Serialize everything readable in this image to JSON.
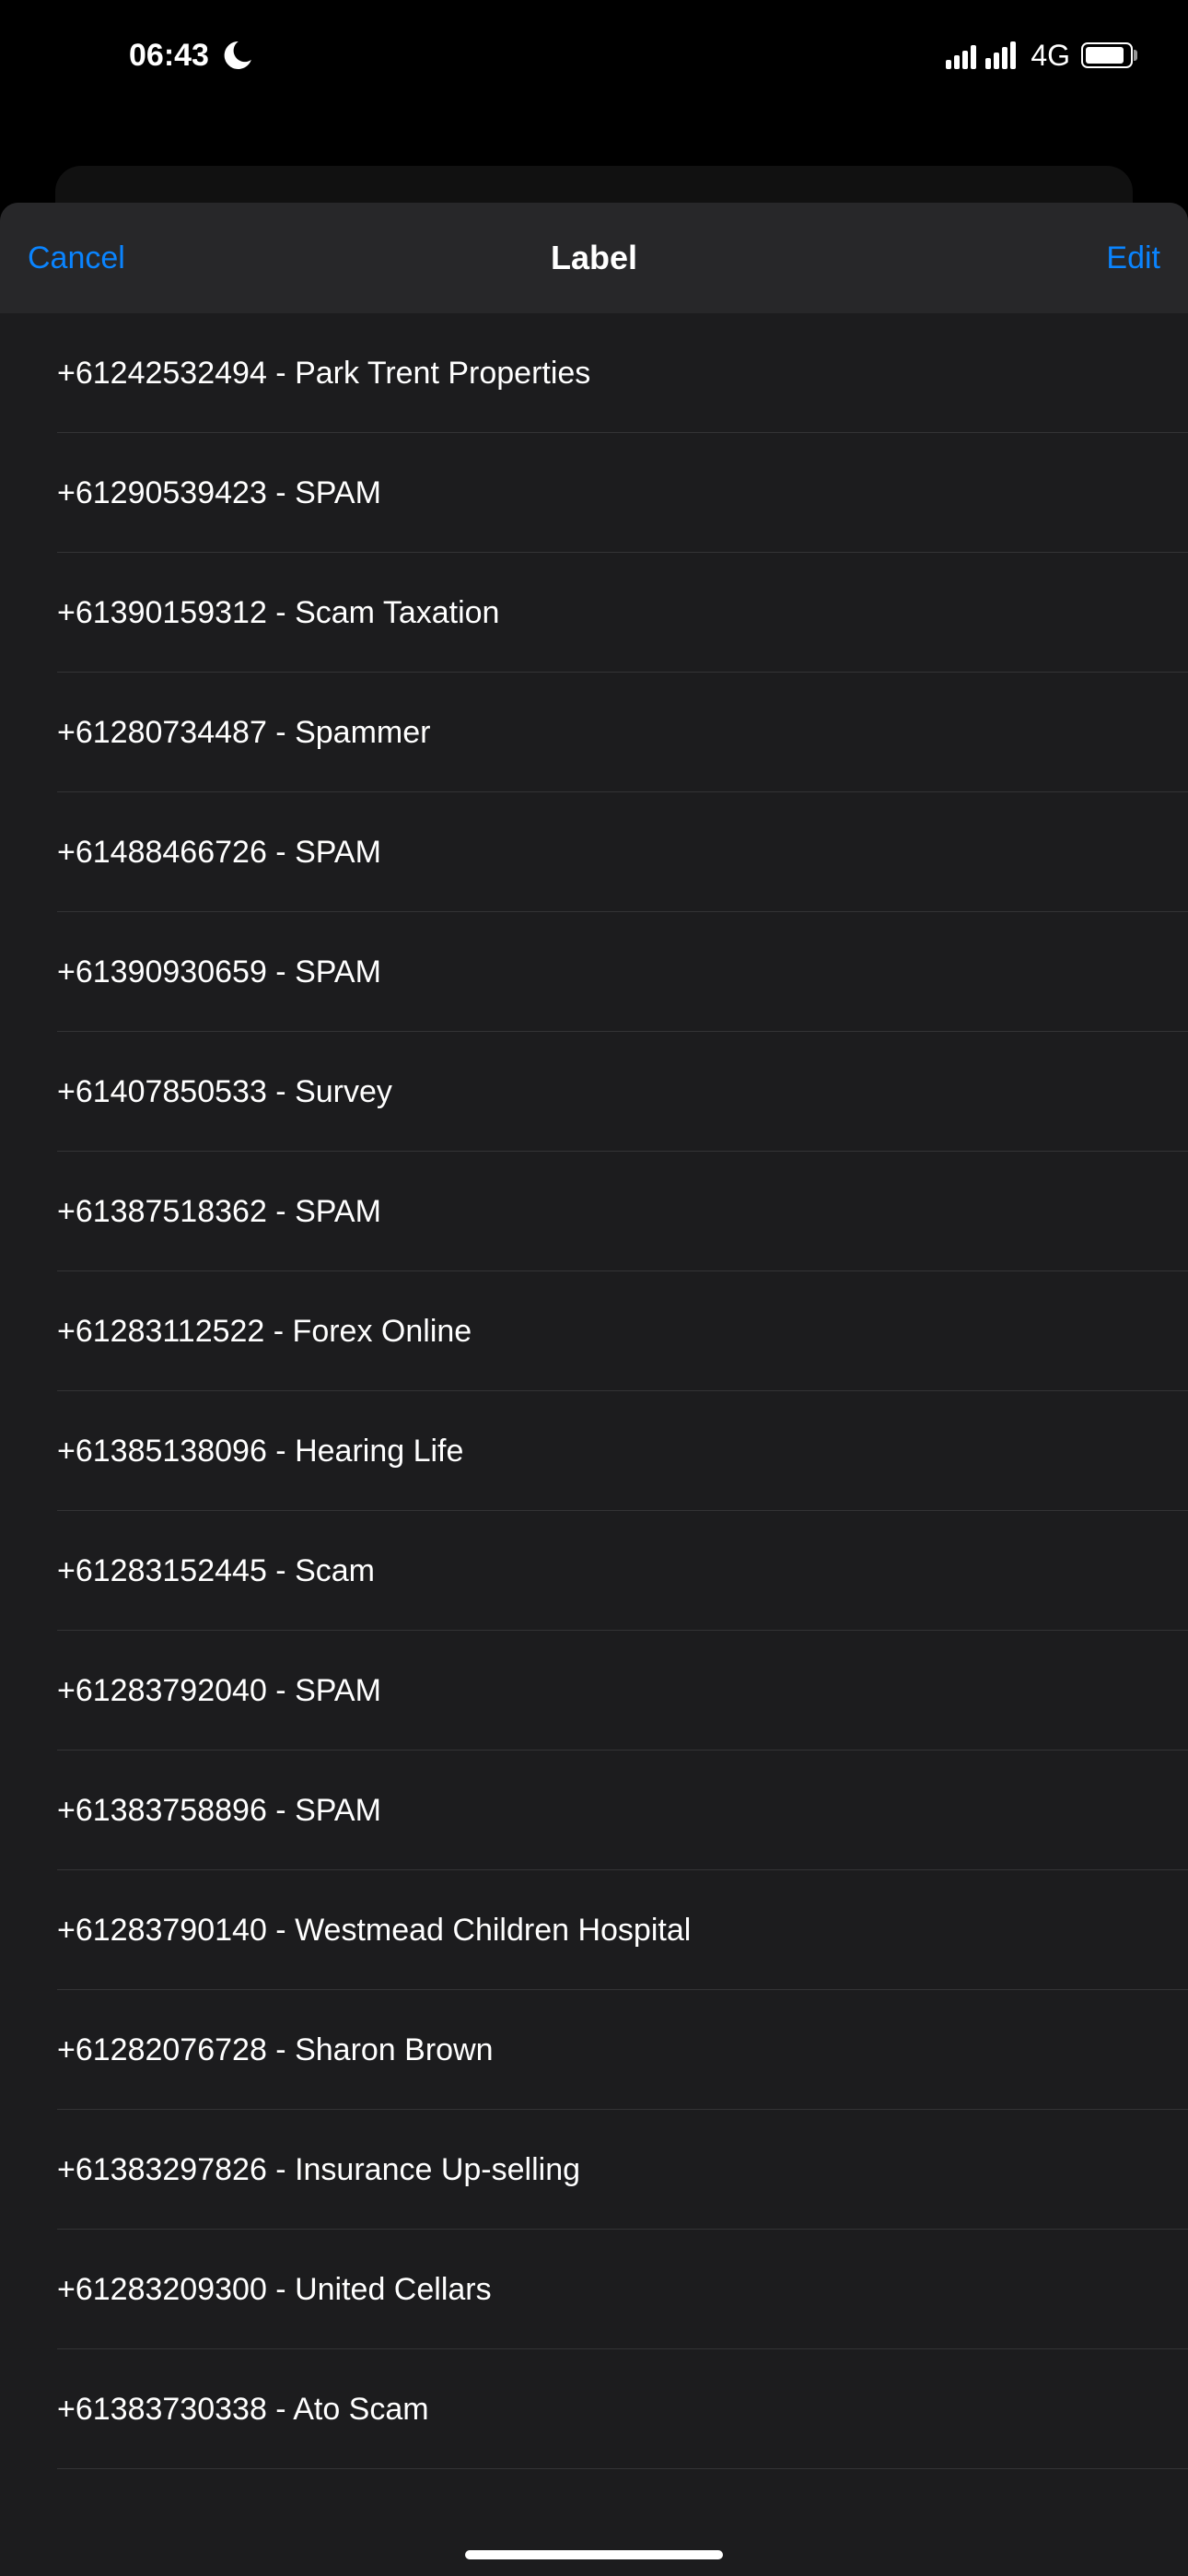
{
  "status": {
    "time": "06:43",
    "network": "4G"
  },
  "sheet": {
    "cancel_label": "Cancel",
    "title": "Label",
    "edit_label": "Edit"
  },
  "list": [
    {
      "text": "+61242532494 - Park Trent Properties"
    },
    {
      "text": "+61290539423 - SPAM"
    },
    {
      "text": "+61390159312 - Scam Taxation"
    },
    {
      "text": "+61280734487 - Spammer"
    },
    {
      "text": "+61488466726 - SPAM"
    },
    {
      "text": "+61390930659 - SPAM"
    },
    {
      "text": "+61407850533 - Survey"
    },
    {
      "text": "+61387518362 - SPAM"
    },
    {
      "text": "+61283112522 - Forex Online"
    },
    {
      "text": "+61385138096 - Hearing Life"
    },
    {
      "text": "+61283152445 - Scam"
    },
    {
      "text": "+61283792040 - SPAM"
    },
    {
      "text": "+61383758896 - SPAM"
    },
    {
      "text": "+61283790140 - Westmead Children Hospital"
    },
    {
      "text": "+61282076728 - Sharon Brown"
    },
    {
      "text": "+61383297826 - Insurance Up-selling"
    },
    {
      "text": "+61283209300 - United Cellars"
    },
    {
      "text": "+61383730338 - Ato Scam"
    }
  ]
}
